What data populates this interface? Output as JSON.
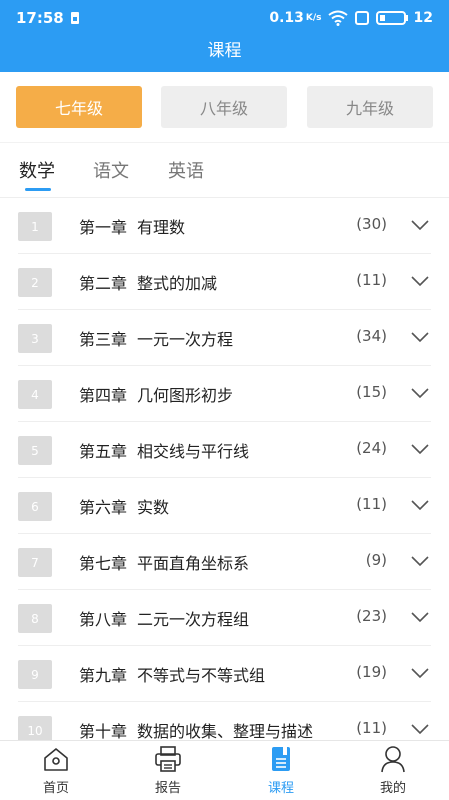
{
  "status_bar": {
    "time": "17:58",
    "network_speed": "0.13",
    "speed_unit": "K/s",
    "battery": "12"
  },
  "header": {
    "title": "课程"
  },
  "grades": [
    {
      "label": "七年级",
      "active": true
    },
    {
      "label": "八年级",
      "active": false
    },
    {
      "label": "九年级",
      "active": false
    }
  ],
  "subjects": [
    {
      "label": "数学",
      "active": true
    },
    {
      "label": "语文",
      "active": false
    },
    {
      "label": "英语",
      "active": false
    }
  ],
  "chapters": [
    {
      "num": "1",
      "chapter": "第一章",
      "name": "有理数",
      "count": "(30)"
    },
    {
      "num": "2",
      "chapter": "第二章",
      "name": "整式的加减",
      "count": "(11)"
    },
    {
      "num": "3",
      "chapter": "第三章",
      "name": "一元一次方程",
      "count": "(34)"
    },
    {
      "num": "4",
      "chapter": "第四章",
      "name": "几何图形初步",
      "count": "(15)"
    },
    {
      "num": "5",
      "chapter": "第五章",
      "name": "相交线与平行线",
      "count": "(24)"
    },
    {
      "num": "6",
      "chapter": "第六章",
      "name": "实数",
      "count": "(11)"
    },
    {
      "num": "7",
      "chapter": "第七章",
      "name": "平面直角坐标系",
      "count": "(9)"
    },
    {
      "num": "8",
      "chapter": "第八章",
      "name": "二元一次方程组",
      "count": "(23)"
    },
    {
      "num": "9",
      "chapter": "第九章",
      "name": "不等式与不等式组",
      "count": "(19)"
    },
    {
      "num": "10",
      "chapter": "第十章",
      "name": "数据的收集、整理与描述",
      "count": "(11)"
    }
  ],
  "bottom_nav": [
    {
      "label": "首页",
      "icon": "home-icon",
      "active": false
    },
    {
      "label": "报告",
      "icon": "printer-icon",
      "active": false
    },
    {
      "label": "课程",
      "icon": "book-icon",
      "active": true
    },
    {
      "label": "我的",
      "icon": "profile-icon",
      "active": false
    }
  ],
  "colors": {
    "primary": "#2c9cf3",
    "accent": "#f5ad48"
  }
}
